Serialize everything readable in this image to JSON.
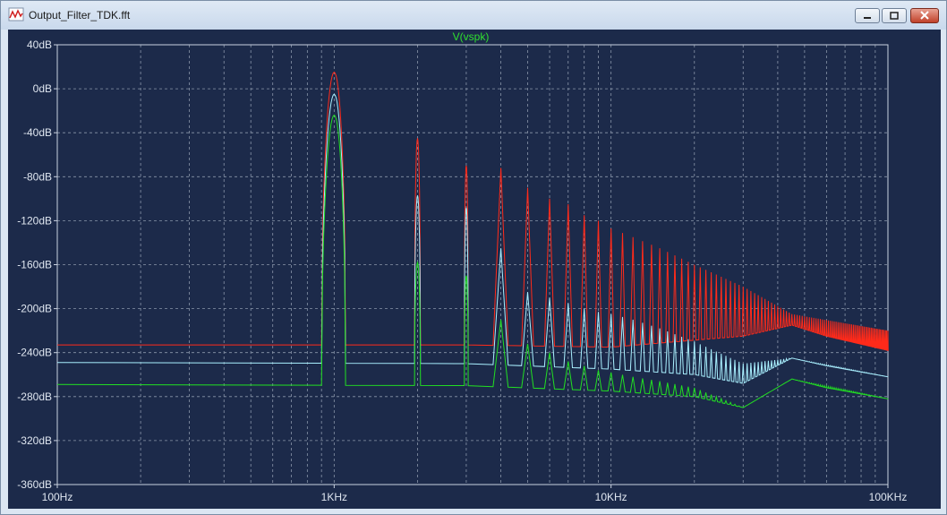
{
  "window": {
    "title": "Output_Filter_TDK.fft"
  },
  "icons": {
    "app": "fft-plot-icon",
    "minimize": "minimize-icon",
    "maximize": "maximize-icon",
    "close": "close-icon"
  },
  "colors": {
    "plot_bg": "#1c2a4a",
    "grid": "#8a96aa",
    "red": "#ff2a1a",
    "cyan": "#a9f0ff",
    "green": "#22e022",
    "title": "#2fe02f"
  },
  "chart_data": {
    "type": "line",
    "title": "V(vspk)",
    "xscale": "log",
    "xlim": [
      100,
      100000
    ],
    "ylim": [
      -360,
      40
    ],
    "grid": true,
    "x_ticks": [
      {
        "value": 100,
        "label": "100Hz"
      },
      {
        "value": 1000,
        "label": "1KHz"
      },
      {
        "value": 10000,
        "label": "10KHz"
      },
      {
        "value": 100000,
        "label": "100KHz"
      }
    ],
    "y_ticks": [
      {
        "value": 40,
        "label": "40dB"
      },
      {
        "value": 0,
        "label": "0dB"
      },
      {
        "value": -40,
        "label": "-40dB"
      },
      {
        "value": -80,
        "label": "-80dB"
      },
      {
        "value": -120,
        "label": "-120dB"
      },
      {
        "value": -160,
        "label": "-160dB"
      },
      {
        "value": -200,
        "label": "-200dB"
      },
      {
        "value": -240,
        "label": "-240dB"
      },
      {
        "value": -280,
        "label": "-280dB"
      },
      {
        "value": -320,
        "label": "-320dB"
      },
      {
        "value": -360,
        "label": "-360dB"
      }
    ],
    "series": [
      {
        "color": "#ff2a1a",
        "floor": [
          [
            100,
            -233
          ],
          [
            3000,
            -233
          ],
          [
            10000,
            -235
          ],
          [
            30000,
            -225
          ],
          [
            45000,
            -215
          ],
          [
            60000,
            -225
          ],
          [
            100000,
            -238
          ]
        ],
        "peaks": [
          [
            1000,
            15
          ],
          [
            2000,
            -45
          ],
          [
            3000,
            -70
          ],
          [
            4000,
            -72
          ],
          [
            5000,
            -90
          ],
          [
            6000,
            -100
          ],
          [
            7000,
            -105
          ],
          [
            8000,
            -115
          ],
          [
            9000,
            -120
          ],
          [
            10000,
            -127
          ],
          [
            12000,
            -135
          ],
          [
            15000,
            -145
          ],
          [
            20000,
            -160
          ],
          [
            30000,
            -180
          ],
          [
            45000,
            -205
          ],
          [
            100000,
            -220
          ]
        ]
      },
      {
        "color": "#a9f0ff",
        "floor": [
          [
            100,
            -249
          ],
          [
            3000,
            -250
          ],
          [
            10000,
            -255
          ],
          [
            20000,
            -260
          ],
          [
            30000,
            -268
          ],
          [
            45000,
            -245
          ],
          [
            60000,
            -252
          ],
          [
            100000,
            -262
          ]
        ],
        "peaks": [
          [
            1000,
            -5
          ],
          [
            2000,
            -97
          ],
          [
            3000,
            -108
          ],
          [
            4000,
            -145
          ],
          [
            5000,
            -185
          ],
          [
            6000,
            -190
          ],
          [
            7000,
            -195
          ],
          [
            8000,
            -200
          ],
          [
            9000,
            -203
          ],
          [
            10000,
            -205
          ],
          [
            12000,
            -210
          ],
          [
            15000,
            -218
          ],
          [
            20000,
            -230
          ],
          [
            30000,
            -250
          ],
          [
            45000,
            -245
          ],
          [
            100000,
            -262
          ]
        ]
      },
      {
        "color": "#22e022",
        "floor": [
          [
            100,
            -269
          ],
          [
            3000,
            -270
          ],
          [
            10000,
            -275
          ],
          [
            20000,
            -280
          ],
          [
            30000,
            -290
          ],
          [
            45000,
            -264
          ],
          [
            60000,
            -272
          ],
          [
            100000,
            -282
          ]
        ],
        "peaks": [
          [
            1000,
            -24
          ],
          [
            2000,
            -158
          ],
          [
            3000,
            -170
          ],
          [
            4000,
            -210
          ],
          [
            5000,
            -232
          ],
          [
            6000,
            -240
          ],
          [
            7000,
            -248
          ],
          [
            8000,
            -252
          ],
          [
            9000,
            -256
          ],
          [
            10000,
            -258
          ],
          [
            12000,
            -262
          ],
          [
            15000,
            -266
          ],
          [
            20000,
            -272
          ],
          [
            30000,
            -290
          ],
          [
            45000,
            -264
          ],
          [
            100000,
            -282
          ]
        ]
      }
    ]
  }
}
